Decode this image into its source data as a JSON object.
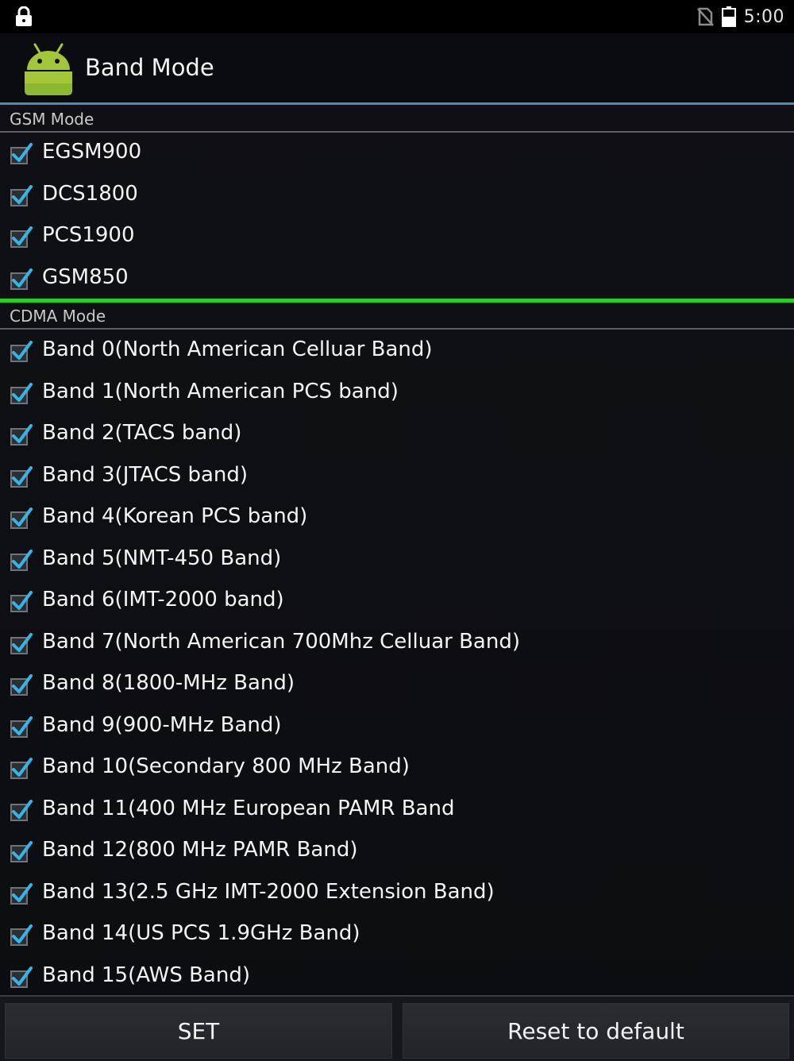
{
  "status_bar": {
    "time": "5:00",
    "icons": [
      "lock-icon",
      "no-sim-icon",
      "battery-icon"
    ]
  },
  "action_bar": {
    "title": "Band Mode",
    "icon": "android-robot-icon"
  },
  "gsm": {
    "header": "GSM Mode",
    "items": [
      {
        "label": "EGSM900",
        "checked": true
      },
      {
        "label": "DCS1800",
        "checked": true
      },
      {
        "label": "PCS1900",
        "checked": true
      },
      {
        "label": "GSM850",
        "checked": true
      }
    ]
  },
  "cdma": {
    "header": "CDMA Mode",
    "items": [
      {
        "label": "Band 0(North American Celluar Band)",
        "checked": true
      },
      {
        "label": "Band 1(North American PCS band)",
        "checked": true
      },
      {
        "label": "Band 2(TACS band)",
        "checked": true
      },
      {
        "label": "Band 3(JTACS band)",
        "checked": true
      },
      {
        "label": "Band 4(Korean PCS band)",
        "checked": true
      },
      {
        "label": "Band 5(NMT-450 Band)",
        "checked": true
      },
      {
        "label": "Band 6(IMT-2000 band)",
        "checked": true
      },
      {
        "label": "Band 7(North American 700Mhz Celluar Band)",
        "checked": true
      },
      {
        "label": "Band 8(1800-MHz Band)",
        "checked": true
      },
      {
        "label": "Band 9(900-MHz Band)",
        "checked": true
      },
      {
        "label": "Band 10(Secondary 800 MHz Band)",
        "checked": true
      },
      {
        "label": "Band 11(400 MHz European PAMR Band",
        "checked": true
      },
      {
        "label": "Band 12(800 MHz PAMR Band)",
        "checked": true
      },
      {
        "label": "Band 13(2.5 GHz IMT-2000 Extension Band)",
        "checked": true
      },
      {
        "label": "Band 14(US PCS 1.9GHz Band)",
        "checked": true
      },
      {
        "label": "Band 15(AWS Band)",
        "checked": true
      }
    ]
  },
  "buttons": {
    "set": "SET",
    "reset": "Reset to default"
  },
  "colors": {
    "accent_blue": "#33b5e5",
    "divider_green": "#23d02a",
    "android_green": "#a4c639"
  }
}
